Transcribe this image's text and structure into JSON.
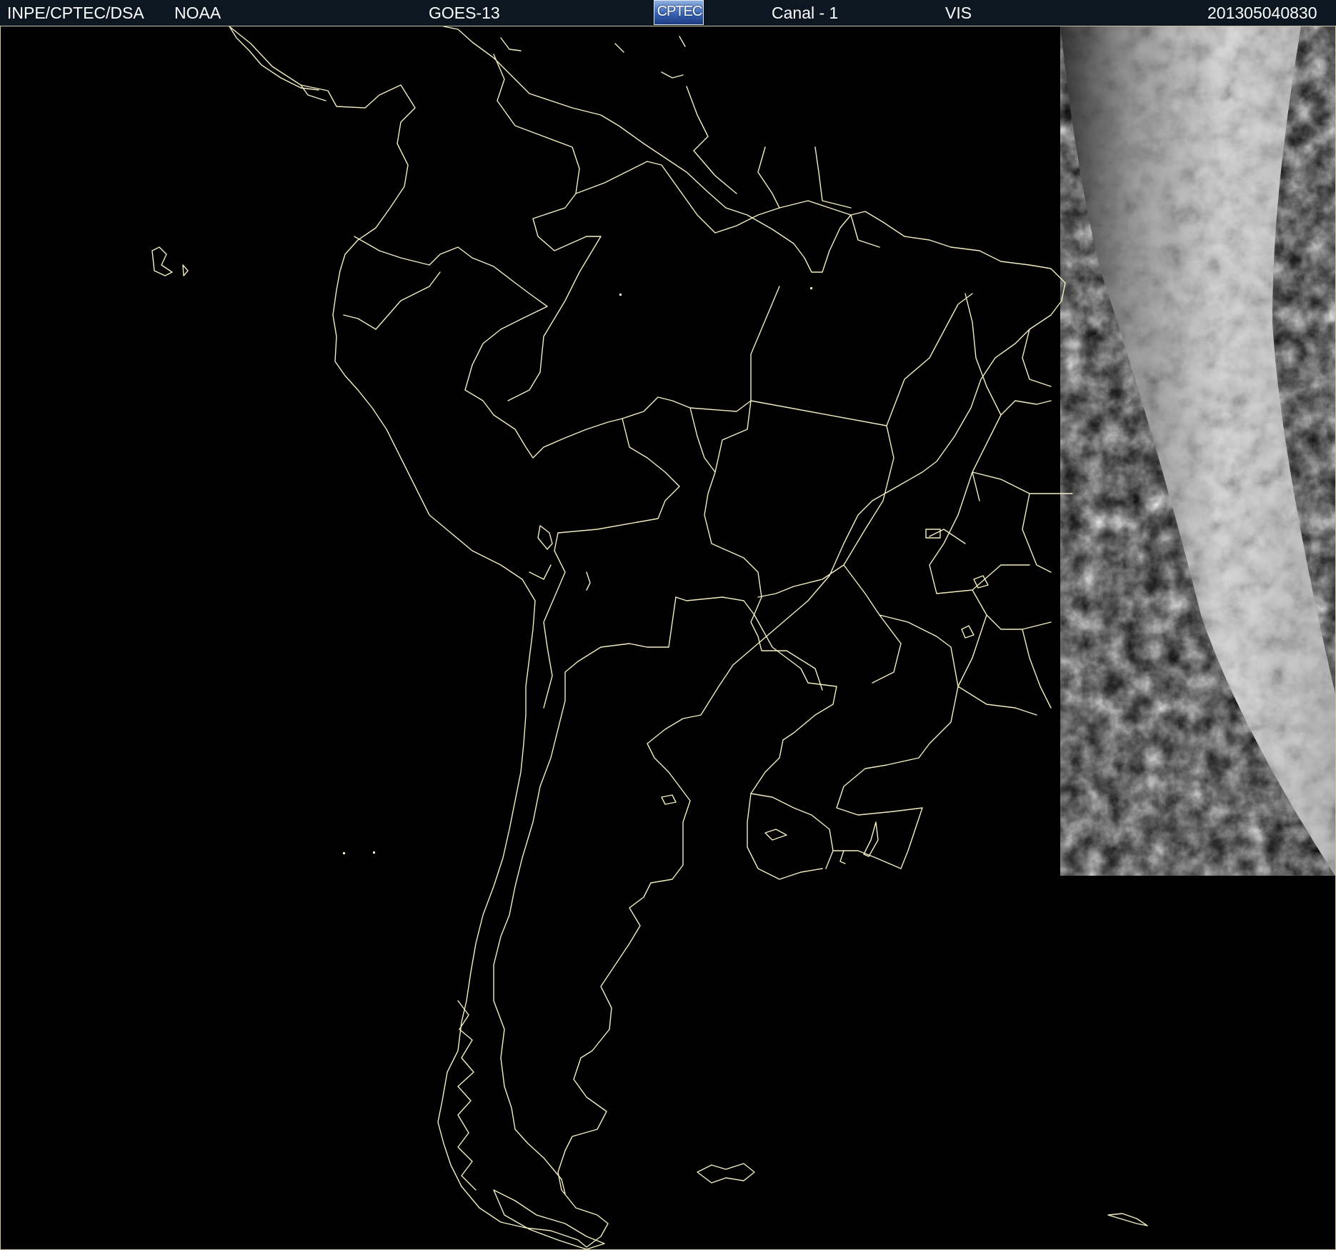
{
  "header": {
    "institution": "INPE/CPTEC/DSA",
    "agency": "NOAA",
    "satellite": "GOES-13",
    "logo_text": "CPTEC",
    "channel": "Canal - 1",
    "band": "VIS",
    "datetime": "201305040830"
  },
  "colors": {
    "background": "#000000",
    "header_bg": "#0d1722",
    "border_lines": "#f2efc2",
    "cloud_white": "#e6e6e6",
    "cloud_gray": "#7a7a7a"
  },
  "map": {
    "region": "South America",
    "layers": [
      "coastline",
      "country-borders",
      "brazil-state-borders",
      "illuminated-cloud-band"
    ]
  }
}
